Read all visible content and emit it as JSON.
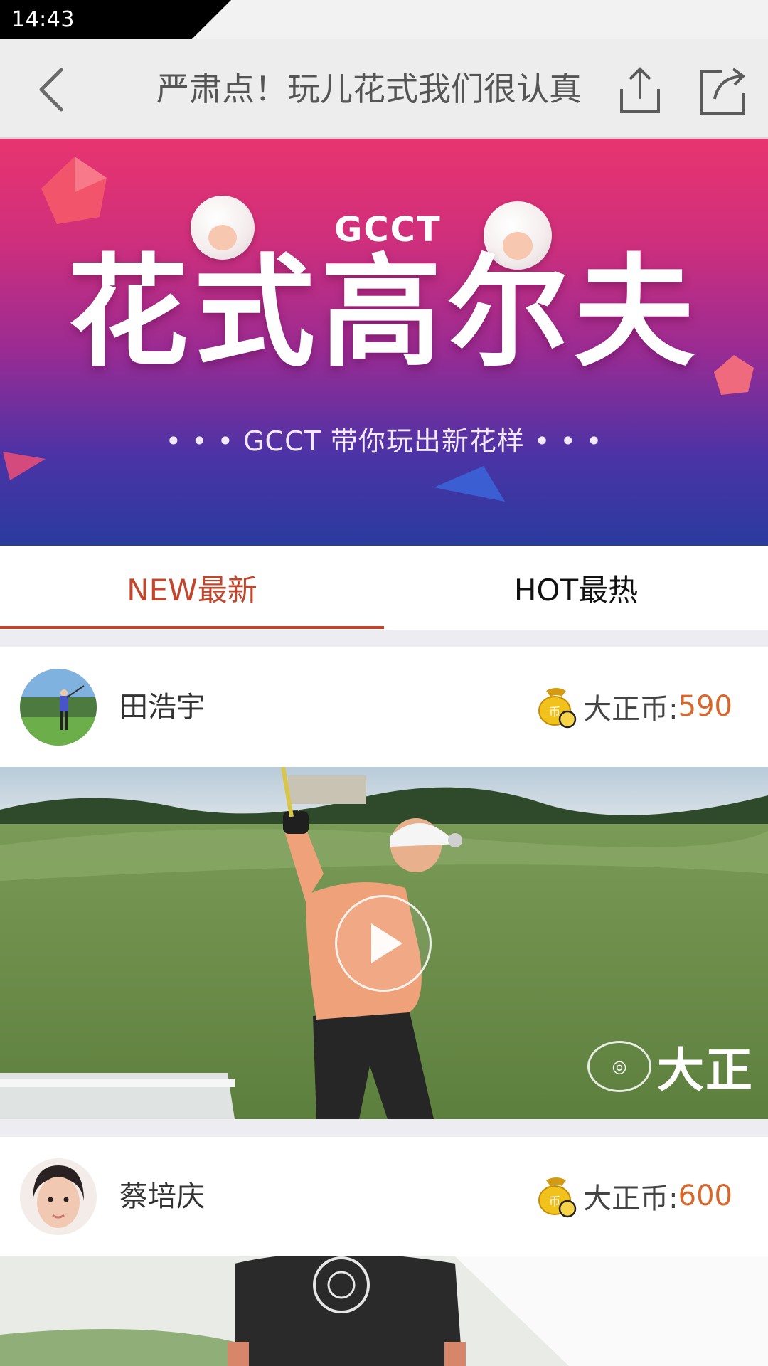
{
  "status_bar": {
    "time": "14:43"
  },
  "header": {
    "title": "严肃点！玩儿花式我们很认真"
  },
  "banner": {
    "logo_text": "GCCT",
    "headline": "花式高尔夫",
    "subtitle": "• • •   GCCT 带你玩出新花样   • • •"
  },
  "tabs": [
    {
      "label": "NEW最新",
      "active": true
    },
    {
      "label": "HOT最热",
      "active": false
    }
  ],
  "feed": [
    {
      "user": "田浩宇",
      "coin_label": "大正币:",
      "coin_value": "590",
      "watermark": "大正"
    },
    {
      "user": "蔡培庆",
      "coin_label": "大正币:",
      "coin_value": "600"
    }
  ],
  "colors": {
    "accent": "#c2452c",
    "coin": "#d8672b",
    "banner_top": "#e8346f",
    "banner_bottom": "#2a3b9e"
  }
}
